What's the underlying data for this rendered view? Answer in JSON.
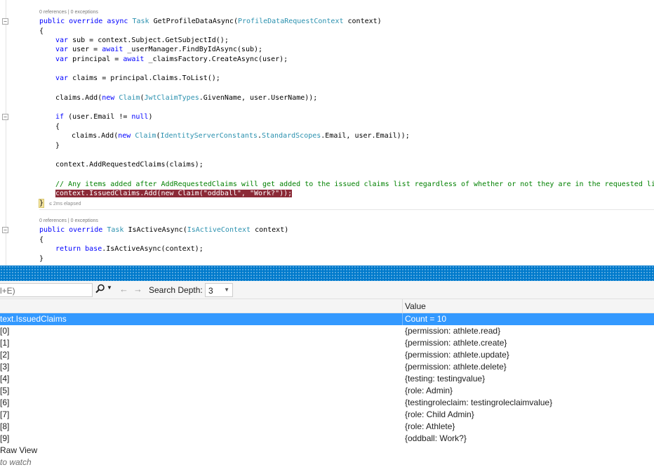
{
  "editor": {
    "lens1": "0 references | 0 exceptions",
    "lens2": "0 references | 0 exceptions",
    "elapsed": "≤ 2ms elapsed",
    "code": {
      "sig1_kw": "public override async ",
      "sig1_ty": "Task ",
      "sig1_name": "GetProfileDataAsync(",
      "sig1_pty": "ProfileDataRequestContext",
      "sig1_rest": " context)",
      "open1": "{",
      "l_sub_kw": "var",
      "l_sub_rest": " sub = context.Subject.GetSubjectId();",
      "l_user_kw": "var",
      "l_user_mid": " user = ",
      "l_user_kw2": "await",
      "l_user_rest": " _userManager.FindByIdAsync(sub);",
      "l_prin_kw": "var",
      "l_prin_mid": " principal = ",
      "l_prin_kw2": "await",
      "l_prin_rest": " _claimsFactory.CreateAsync(user);",
      "l_claims_kw": "var",
      "l_claims_rest": " claims = principal.Claims.ToList();",
      "l_add1_a": "claims.Add(",
      "l_add1_kw": "new ",
      "l_add1_ty": "Claim",
      "l_add1_b": "(",
      "l_add1_ty2": "JwtClaimTypes",
      "l_add1_c": ".GivenName, user.UserName));",
      "l_if_kw": "if",
      "l_if_a": " (user.Email != ",
      "l_if_kw2": "null",
      "l_if_b": ")",
      "open2": "{",
      "l_add2_a": "claims.Add(",
      "l_add2_kw": "new ",
      "l_add2_ty": "Claim",
      "l_add2_b": "(",
      "l_add2_ty2": "IdentityServerConstants",
      "l_add2_c": ".",
      "l_add2_ty3": "StandardScopes",
      "l_add2_d": ".Email, user.Email));",
      "close2": "}",
      "l_req": "context.AddRequestedClaims(claims);",
      "l_comment": "// Any items added after AddRequestedClaims will get added to the issued claims list regardless of whether or not they are in the requested list.",
      "l_hl_a": "context.IssuedClaims.Add(new Claim(",
      "l_hl_s1": "\"oddball\"",
      "l_hl_b": ", ",
      "l_hl_s2": "\"Work?\"",
      "l_hl_c": "));",
      "close1": "}",
      "sig2_kw": "public override ",
      "sig2_ty": "Task ",
      "sig2_name": "IsActiveAsync(",
      "sig2_pty": "IsActiveContext",
      "sig2_rest": " context)",
      "open3": "{",
      "l_ret_kw": "return",
      "l_ret_kw2": " base",
      "l_ret_rest": ".IsActiveAsync(context);",
      "close3": "}"
    }
  },
  "watch": {
    "search_placeholder": "l+E)",
    "search_icon": "search-icon",
    "depth_label": "Search Depth:",
    "depth_value": "3",
    "value_header": "Value",
    "rows": [
      {
        "name": "text.IssuedClaims",
        "value": "Count = 10",
        "selected": true
      },
      {
        "name": "[0]",
        "value": "{permission: athlete.read}"
      },
      {
        "name": "[1]",
        "value": "{permission: athlete.create}"
      },
      {
        "name": "[2]",
        "value": "{permission: athlete.update}"
      },
      {
        "name": "[3]",
        "value": "{permission: athlete.delete}"
      },
      {
        "name": "[4]",
        "value": "{testing: testingvalue}"
      },
      {
        "name": "[5]",
        "value": "{role: Admin}"
      },
      {
        "name": "[6]",
        "value": "{testingroleclaim: testingroleclaimvalue}"
      },
      {
        "name": "[7]",
        "value": "{role: Child Admin}"
      },
      {
        "name": "[8]",
        "value": "{role: Athlete}"
      },
      {
        "name": "[9]",
        "value": "{oddball: Work?}"
      }
    ],
    "raw_view": "Raw View",
    "add_watch": "to watch"
  },
  "colors": {
    "selection": "#3399ff",
    "splitter": "#007acc",
    "highlight_line": "#8b2a37"
  }
}
